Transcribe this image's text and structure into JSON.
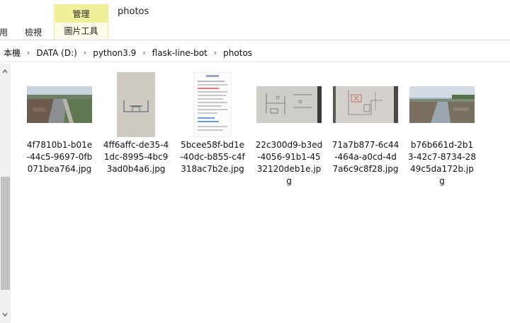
{
  "ribbon": {
    "manage_tab": "管理",
    "folder_title": "photos",
    "tab_partial": "用",
    "tab_view": "檢視",
    "tab_picture_tools": "圖片工具"
  },
  "address": {
    "crumbs": [
      "本機",
      "DATA (D:)",
      "python3.9",
      "flask-line-bot",
      "photos"
    ]
  },
  "files": [
    {
      "name": "4f7810b1-b01e-44c5-9697-0fb071bea764.jpg",
      "lines": [
        "4f7810b1-b01e",
        "-44c5-9697-0fb",
        "071bea764.jpg"
      ],
      "thumb": "landscape-canal"
    },
    {
      "name": "4ff6affc-de35-41dc-8995-4bc93ad0b4a6.jpg",
      "lines": [
        "4ff6affc-de35-4",
        "1dc-8995-4bc9",
        "3ad0b4a6.jpg"
      ],
      "thumb": "portrait-sketch"
    },
    {
      "name": "5bcee58f-bd1e-40dc-b855-c4f318ac7b2e.jpg",
      "lines": [
        "5bcee58f-bd1e",
        "-40dc-b855-c4f",
        "318ac7b2e.jpg"
      ],
      "thumb": "portrait-document"
    },
    {
      "name": "22c300d9-b3ed-4056-91b1-4532120deb1e.jpg",
      "lines": [
        "22c300d9-b3ed",
        "-4056-91b1-45",
        "32120deb1e.jp",
        "g"
      ],
      "thumb": "landscape-drawing"
    },
    {
      "name": "71a7b877-6c44-464a-a0cd-4d7a6c9c8f28.jpg",
      "lines": [
        "71a7b877-6c44",
        "-464a-a0cd-4d",
        "7a6c9c8f28.jpg"
      ],
      "thumb": "landscape-plan"
    },
    {
      "name": "b76b661d-2b13-42c7-8734-2849c5da172b.jpg",
      "lines": [
        "b76b661d-2b1",
        "3-42c7-8734-28",
        "49c5da172b.jp",
        "g"
      ],
      "thumb": "landscape-ditch"
    }
  ]
}
